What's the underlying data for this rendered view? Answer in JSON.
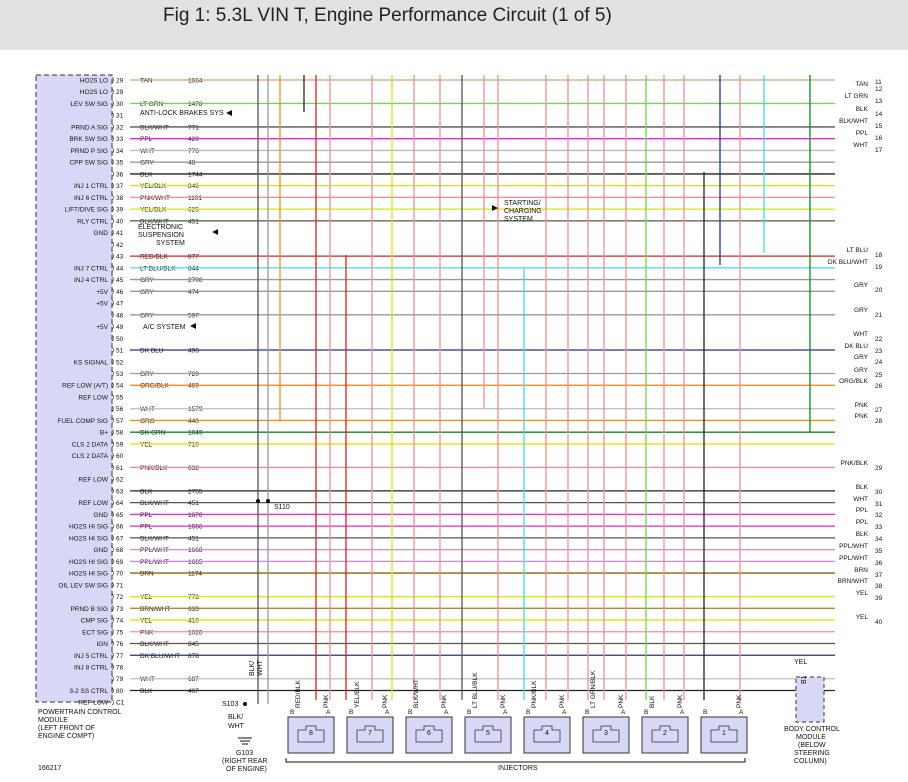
{
  "title": "Fig 1: 5.3L VIN T, Engine Performance Circuit (1 of 5)",
  "pcm": {
    "name_lines": [
      "POWERTRAIN CONTROL",
      "MODULE",
      "(LEFT FRONT OF",
      "ENGINE COMPT)"
    ],
    "fig_number": "166217",
    "pins": [
      {
        "func": "HO2S LO",
        "pin": "29",
        "color": "TAN",
        "circuit": "1664",
        "hex": "#c8a47c"
      },
      {
        "func": "HO2S LO",
        "pin": "29",
        "color": "",
        "circuit": "",
        "hex": ""
      },
      {
        "func": "LEV SW SIG",
        "pin": "30",
        "color": "LT GRN",
        "circuit": "1478",
        "hex": "#66dd44"
      },
      {
        "func": "",
        "pin": "31",
        "color": "",
        "circuit": "",
        "hex": ""
      },
      {
        "func": "PRND A SIG",
        "pin": "32",
        "color": "BLK/WHT",
        "circuit": "771",
        "hex": "#555555"
      },
      {
        "func": "BRK SW SIG",
        "pin": "33",
        "color": "PPL",
        "circuit": "420",
        "hex": "#ee22dd"
      },
      {
        "func": "PRND P SIG",
        "pin": "34",
        "color": "WHT",
        "circuit": "776",
        "hex": "#bbbbbb"
      },
      {
        "func": "CPP SW SIG",
        "pin": "35",
        "color": "GRY",
        "circuit": "48",
        "hex": "#999999"
      },
      {
        "func": "",
        "pin": "36",
        "color": "BLK",
        "circuit": "1744",
        "hex": "#222222"
      },
      {
        "func": "INJ 1 CTRL",
        "pin": "37",
        "color": "YEL/BLK",
        "circuit": "846",
        "hex": "#dddd22"
      },
      {
        "func": "INJ 6 CTRL",
        "pin": "38",
        "color": "PNK/WHT",
        "circuit": "1101",
        "hex": "#f09090"
      },
      {
        "func": "LIFT/DIVE SIG",
        "pin": "39",
        "color": "YEL/BLK",
        "circuit": "625",
        "hex": "#dddd22"
      },
      {
        "func": "RLY CTRL",
        "pin": "40",
        "color": "BLK/WHT",
        "circuit": "451",
        "hex": "#555555"
      },
      {
        "func": "GND",
        "pin": "41",
        "color": "",
        "circuit": "",
        "hex": ""
      },
      {
        "func": "",
        "pin": "42",
        "color": "",
        "circuit": "",
        "hex": ""
      },
      {
        "func": "",
        "pin": "43",
        "color": "RED/BLK",
        "circuit": "877",
        "hex": "#e02020"
      },
      {
        "func": "INJ 7 CTRL",
        "pin": "44",
        "color": "LT BLU/BLK",
        "circuit": "844",
        "hex": "#44dddd"
      },
      {
        "func": "INJ 4 CTRL",
        "pin": "45",
        "color": "GRY",
        "circuit": "2700",
        "hex": "#999999"
      },
      {
        "func": "+5V",
        "pin": "46",
        "color": "GRY",
        "circuit": "474",
        "hex": "#999999"
      },
      {
        "func": "+5V",
        "pin": "47",
        "color": "",
        "circuit": "",
        "hex": ""
      },
      {
        "func": "",
        "pin": "48",
        "color": "GRY",
        "circuit": "597",
        "hex": "#999999"
      },
      {
        "func": "+5V",
        "pin": "49",
        "color": "",
        "circuit": "",
        "hex": ""
      },
      {
        "func": "",
        "pin": "50",
        "color": "",
        "circuit": "",
        "hex": ""
      },
      {
        "func": "",
        "pin": "51",
        "color": "DK BLU",
        "circuit": "496",
        "hex": "#223388"
      },
      {
        "func": "KS SIGNAL",
        "pin": "52",
        "color": "",
        "circuit": "",
        "hex": ""
      },
      {
        "func": "",
        "pin": "53",
        "color": "GRY",
        "circuit": "720",
        "hex": "#999999"
      },
      {
        "func": "REF LOW (A/T)",
        "pin": "54",
        "color": "ORG/BLK",
        "circuit": "469",
        "hex": "#f08020"
      },
      {
        "func": "REF LOW",
        "pin": "55",
        "color": "",
        "circuit": "",
        "hex": ""
      },
      {
        "func": "",
        "pin": "56",
        "color": "WHT",
        "circuit": "1579",
        "hex": "#bbbbbb"
      },
      {
        "func": "FUEL COMP SIG",
        "pin": "57",
        "color": "ORG",
        "circuit": "440",
        "hex": "#f09020"
      },
      {
        "func": "B+",
        "pin": "58",
        "color": "DK GRN",
        "circuit": "1049",
        "hex": "#118822"
      },
      {
        "func": "CLS 2 DATA",
        "pin": "59",
        "color": "YEL",
        "circuit": "710",
        "hex": "#e6e600"
      },
      {
        "func": "CLS 2 DATA",
        "pin": "60",
        "color": "",
        "circuit": "",
        "hex": ""
      },
      {
        "func": "",
        "pin": "61",
        "color": "PNK/BLK",
        "circuit": "632",
        "hex": "#f09090"
      },
      {
        "func": "REF LOW",
        "pin": "62",
        "color": "",
        "circuit": "",
        "hex": ""
      },
      {
        "func": "",
        "pin": "63",
        "color": "BLK",
        "circuit": "2755",
        "hex": "#222222"
      },
      {
        "func": "REF LOW",
        "pin": "64",
        "color": "BLK/WHT",
        "circuit": "451",
        "hex": "#555555"
      },
      {
        "func": "GND",
        "pin": "65",
        "color": "PPL",
        "circuit": "1670",
        "hex": "#ee22dd"
      },
      {
        "func": "HO2S HI SIG",
        "pin": "66",
        "color": "PPL",
        "circuit": "1666",
        "hex": "#ee22dd"
      },
      {
        "func": "HO2S HI SIG",
        "pin": "67",
        "color": "BLK/WHT",
        "circuit": "451",
        "hex": "#555555"
      },
      {
        "func": "GND",
        "pin": "68",
        "color": "PPL/WHT",
        "circuit": "1668",
        "hex": "#cc88dd"
      },
      {
        "func": "HO2S HI SIG",
        "pin": "69",
        "color": "PPL/WHT",
        "circuit": "1665",
        "hex": "#cc88dd"
      },
      {
        "func": "HO2S HI SIG",
        "pin": "70",
        "color": "BRN",
        "circuit": "1174",
        "hex": "#886600"
      },
      {
        "func": "OIL LEV SW SIG",
        "pin": "71",
        "color": "",
        "circuit": "",
        "hex": ""
      },
      {
        "func": "",
        "pin": "72",
        "color": "YEL",
        "circuit": "772",
        "hex": "#e6e600"
      },
      {
        "func": "PRND B SIG",
        "pin": "73",
        "color": "BRN/WHT",
        "circuit": "633",
        "hex": "#aa8844"
      },
      {
        "func": "CMP SIG",
        "pin": "74",
        "color": "YEL",
        "circuit": "410",
        "hex": "#e6e600"
      },
      {
        "func": "ECT SIG",
        "pin": "75",
        "color": "PNK",
        "circuit": "1020",
        "hex": "#f09090"
      },
      {
        "func": "IGN",
        "pin": "76",
        "color": "BLK/WHT",
        "circuit": "845",
        "hex": "#555555"
      },
      {
        "func": "INJ 5 CTRL",
        "pin": "77",
        "color": "DK BLU/WHT",
        "circuit": "878",
        "hex": "#223388"
      },
      {
        "func": "INJ 8 CTRL",
        "pin": "78",
        "color": "",
        "circuit": "",
        "hex": ""
      },
      {
        "func": "",
        "pin": "79",
        "color": "WHT",
        "circuit": "687",
        "hex": "#bbbbbb"
      },
      {
        "func": "3-2 SS CTRL",
        "pin": "80",
        "color": "BLK",
        "circuit": "407",
        "hex": "#222222"
      },
      {
        "func": "REF LOW",
        "pin": "C1",
        "color": "",
        "circuit": "",
        "hex": ""
      }
    ]
  },
  "right_wires": [
    {
      "label": "",
      "num": "11"
    },
    {
      "label": "TAN",
      "num": "12"
    },
    {
      "label": "LT GRN",
      "num": "13"
    },
    {
      "label": "BLK",
      "num": "14"
    },
    {
      "label": "BLK/WHT",
      "num": "15"
    },
    {
      "label": "PPL",
      "num": "16"
    },
    {
      "label": "WHT",
      "num": "17"
    },
    {
      "label": "LT BLU",
      "num": "18"
    },
    {
      "label": "DK BLU/WHT",
      "num": "19"
    },
    {
      "label": "GRY",
      "num": "20"
    },
    {
      "label": "GRY",
      "num": "21"
    },
    {
      "label": "WHT",
      "num": "22"
    },
    {
      "label": "DK BLU",
      "num": "23"
    },
    {
      "label": "GRY",
      "num": "24"
    },
    {
      "label": "GRY",
      "num": "25"
    },
    {
      "label": "ORG/BLK",
      "num": "26"
    },
    {
      "label": "PNK",
      "num": "27"
    },
    {
      "label": "PNK",
      "num": "28"
    },
    {
      "label": "PNK/BLK",
      "num": "29"
    },
    {
      "label": "BLK",
      "num": "30"
    },
    {
      "label": "WHT",
      "num": "31"
    },
    {
      "label": "PPL",
      "num": "32"
    },
    {
      "label": "PPL",
      "num": "33"
    },
    {
      "label": "BLK",
      "num": "34"
    },
    {
      "label": "PPL/WHT",
      "num": "35"
    },
    {
      "label": "PPL/WHT",
      "num": "36"
    },
    {
      "label": "BRN",
      "num": "37"
    },
    {
      "label": "BRN/WHT",
      "num": "38"
    },
    {
      "label": "YEL",
      "num": "39"
    },
    {
      "label": "YEL",
      "num": "40"
    }
  ],
  "callouts": {
    "antilock": "ANTI-LOCK BRAKES SYS",
    "electronic_suspension": [
      "ELECTRONIC",
      "SUSPENSION",
      "SYSTEM"
    ],
    "starting_charging": [
      "STARTING/",
      "CHARGING",
      "SYSTEM"
    ],
    "ac_system": "A/C SYSTEM",
    "splice_s110": "S110",
    "splice_s103": "S103",
    "ground_g103": [
      "G103",
      "(RIGHT REAR",
      "OF ENGINE)"
    ],
    "ground_wire_lines": [
      "BLK/",
      "WHT"
    ],
    "s103_wire_lines": [
      "BLK/",
      "WHT"
    ]
  },
  "injectors": {
    "label": "INJECTORS",
    "units": [
      {
        "num": "8",
        "wireA": "PNK",
        "wireB": "RED/BLK",
        "hexB": "#e02020"
      },
      {
        "num": "7",
        "wireA": "PNK",
        "wireB": "YEL/BLK",
        "hexB": "#dddd22"
      },
      {
        "num": "6",
        "wireA": "PNK",
        "wireB": "BLK/WHT",
        "hexB": "#555555"
      },
      {
        "num": "5",
        "wireA": "PNK",
        "wireB": "LT BLU/BLK",
        "hexB": "#44dddd"
      },
      {
        "num": "4",
        "wireA": "PNK",
        "wireB": "PNK/BLK",
        "hexB": "#f09090"
      },
      {
        "num": "3",
        "wireA": "PNK",
        "wireB": "LT GRN/BLK",
        "hexB": "#66dd44"
      },
      {
        "num": "2",
        "wireA": "PNK",
        "wireB": "BLK",
        "hexB": "#222222"
      },
      {
        "num": "1",
        "wireA": "PNK",
        "wireB": "",
        "hexB": ""
      }
    ]
  },
  "bcm": {
    "lines": [
      "BODY CONTROL",
      "MODULE",
      "(BELOW",
      "STEERING",
      "COLUMN)"
    ],
    "wire": "YEL",
    "pin": "B1"
  }
}
